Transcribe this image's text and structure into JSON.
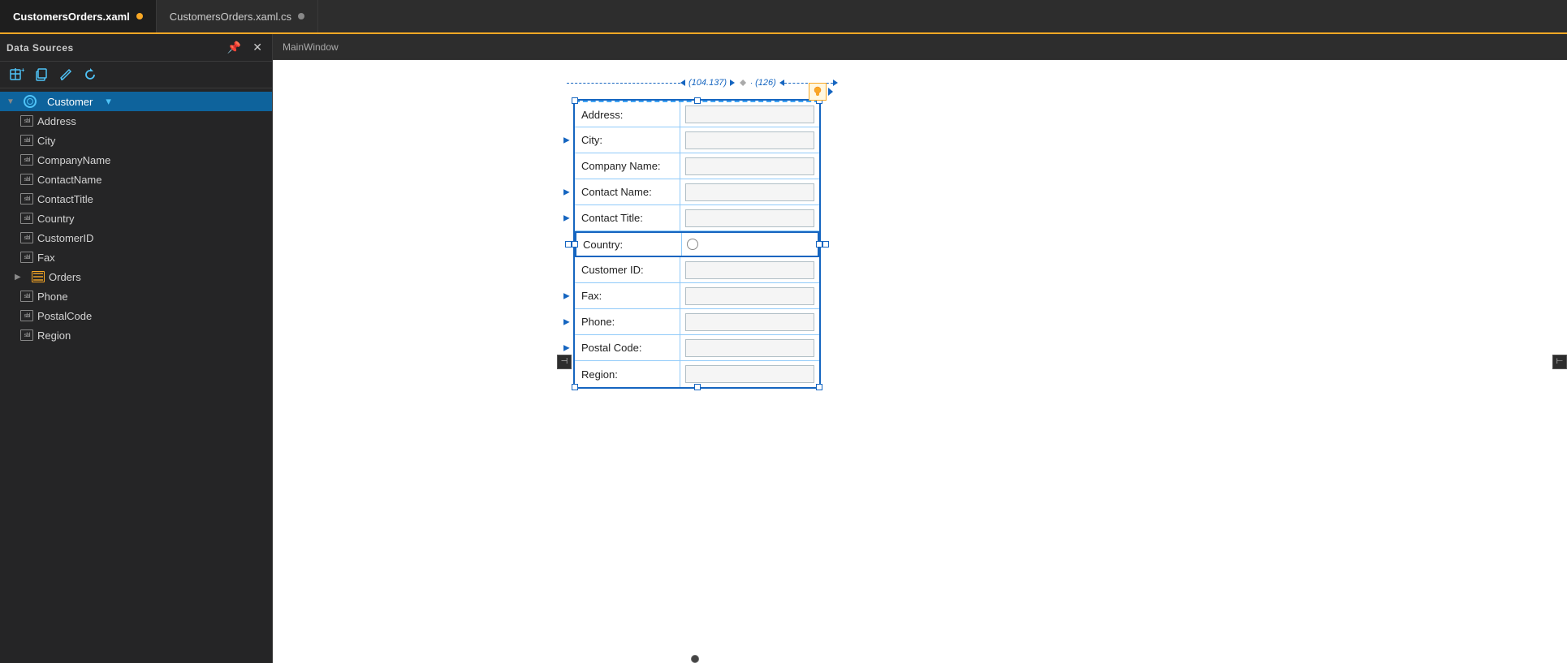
{
  "tabs": [
    {
      "id": "xaml",
      "label": "CustomersOrders.xaml",
      "active": true,
      "dot_color": "orange"
    },
    {
      "id": "xaml-cs",
      "label": "CustomersOrders.xaml.cs",
      "active": false,
      "dot_color": "gray"
    }
  ],
  "sidebar": {
    "title": "Data Sources",
    "toolbar": {
      "add_tooltip": "Add Data Source",
      "copy_tooltip": "Copy",
      "refresh_tooltip": "Refresh",
      "edit_tooltip": "Edit"
    },
    "tree": {
      "root": {
        "label": "Customer",
        "icon": "datasource",
        "expanded": true,
        "fields": [
          {
            "label": "Address",
            "icon": "field"
          },
          {
            "label": "City",
            "icon": "field"
          },
          {
            "label": "CompanyName",
            "icon": "field"
          },
          {
            "label": "ContactName",
            "icon": "field"
          },
          {
            "label": "ContactTitle",
            "icon": "field"
          },
          {
            "label": "Country",
            "icon": "field"
          },
          {
            "label": "CustomerID",
            "icon": "field"
          },
          {
            "label": "Fax",
            "icon": "field"
          },
          {
            "label": "Orders",
            "icon": "table",
            "expandable": true
          },
          {
            "label": "Phone",
            "icon": "field"
          },
          {
            "label": "PostalCode",
            "icon": "field"
          },
          {
            "label": "Region",
            "icon": "field"
          }
        ]
      }
    }
  },
  "designer": {
    "window_label": "MainWindow",
    "dimension_left": "(104.137)",
    "dimension_right": "(126)",
    "form": {
      "fields": [
        {
          "label": "Address:",
          "type": "text",
          "has_nav": false
        },
        {
          "label": "City:",
          "type": "text",
          "has_nav": true
        },
        {
          "label": "Company Name:",
          "type": "text",
          "has_nav": false
        },
        {
          "label": "Contact Name:",
          "type": "text",
          "has_nav": true
        },
        {
          "label": "Contact Title:",
          "type": "text",
          "has_nav": true
        },
        {
          "label": "Country:",
          "type": "radio",
          "has_nav": false
        },
        {
          "label": "Customer ID:",
          "type": "text",
          "has_nav": false
        },
        {
          "label": "Fax:",
          "type": "text",
          "has_nav": true
        },
        {
          "label": "Phone:",
          "type": "text",
          "has_nav": true
        },
        {
          "label": "Postal Code:",
          "type": "text",
          "has_nav": true
        },
        {
          "label": "Region:",
          "type": "text",
          "has_nav": false
        }
      ]
    }
  }
}
